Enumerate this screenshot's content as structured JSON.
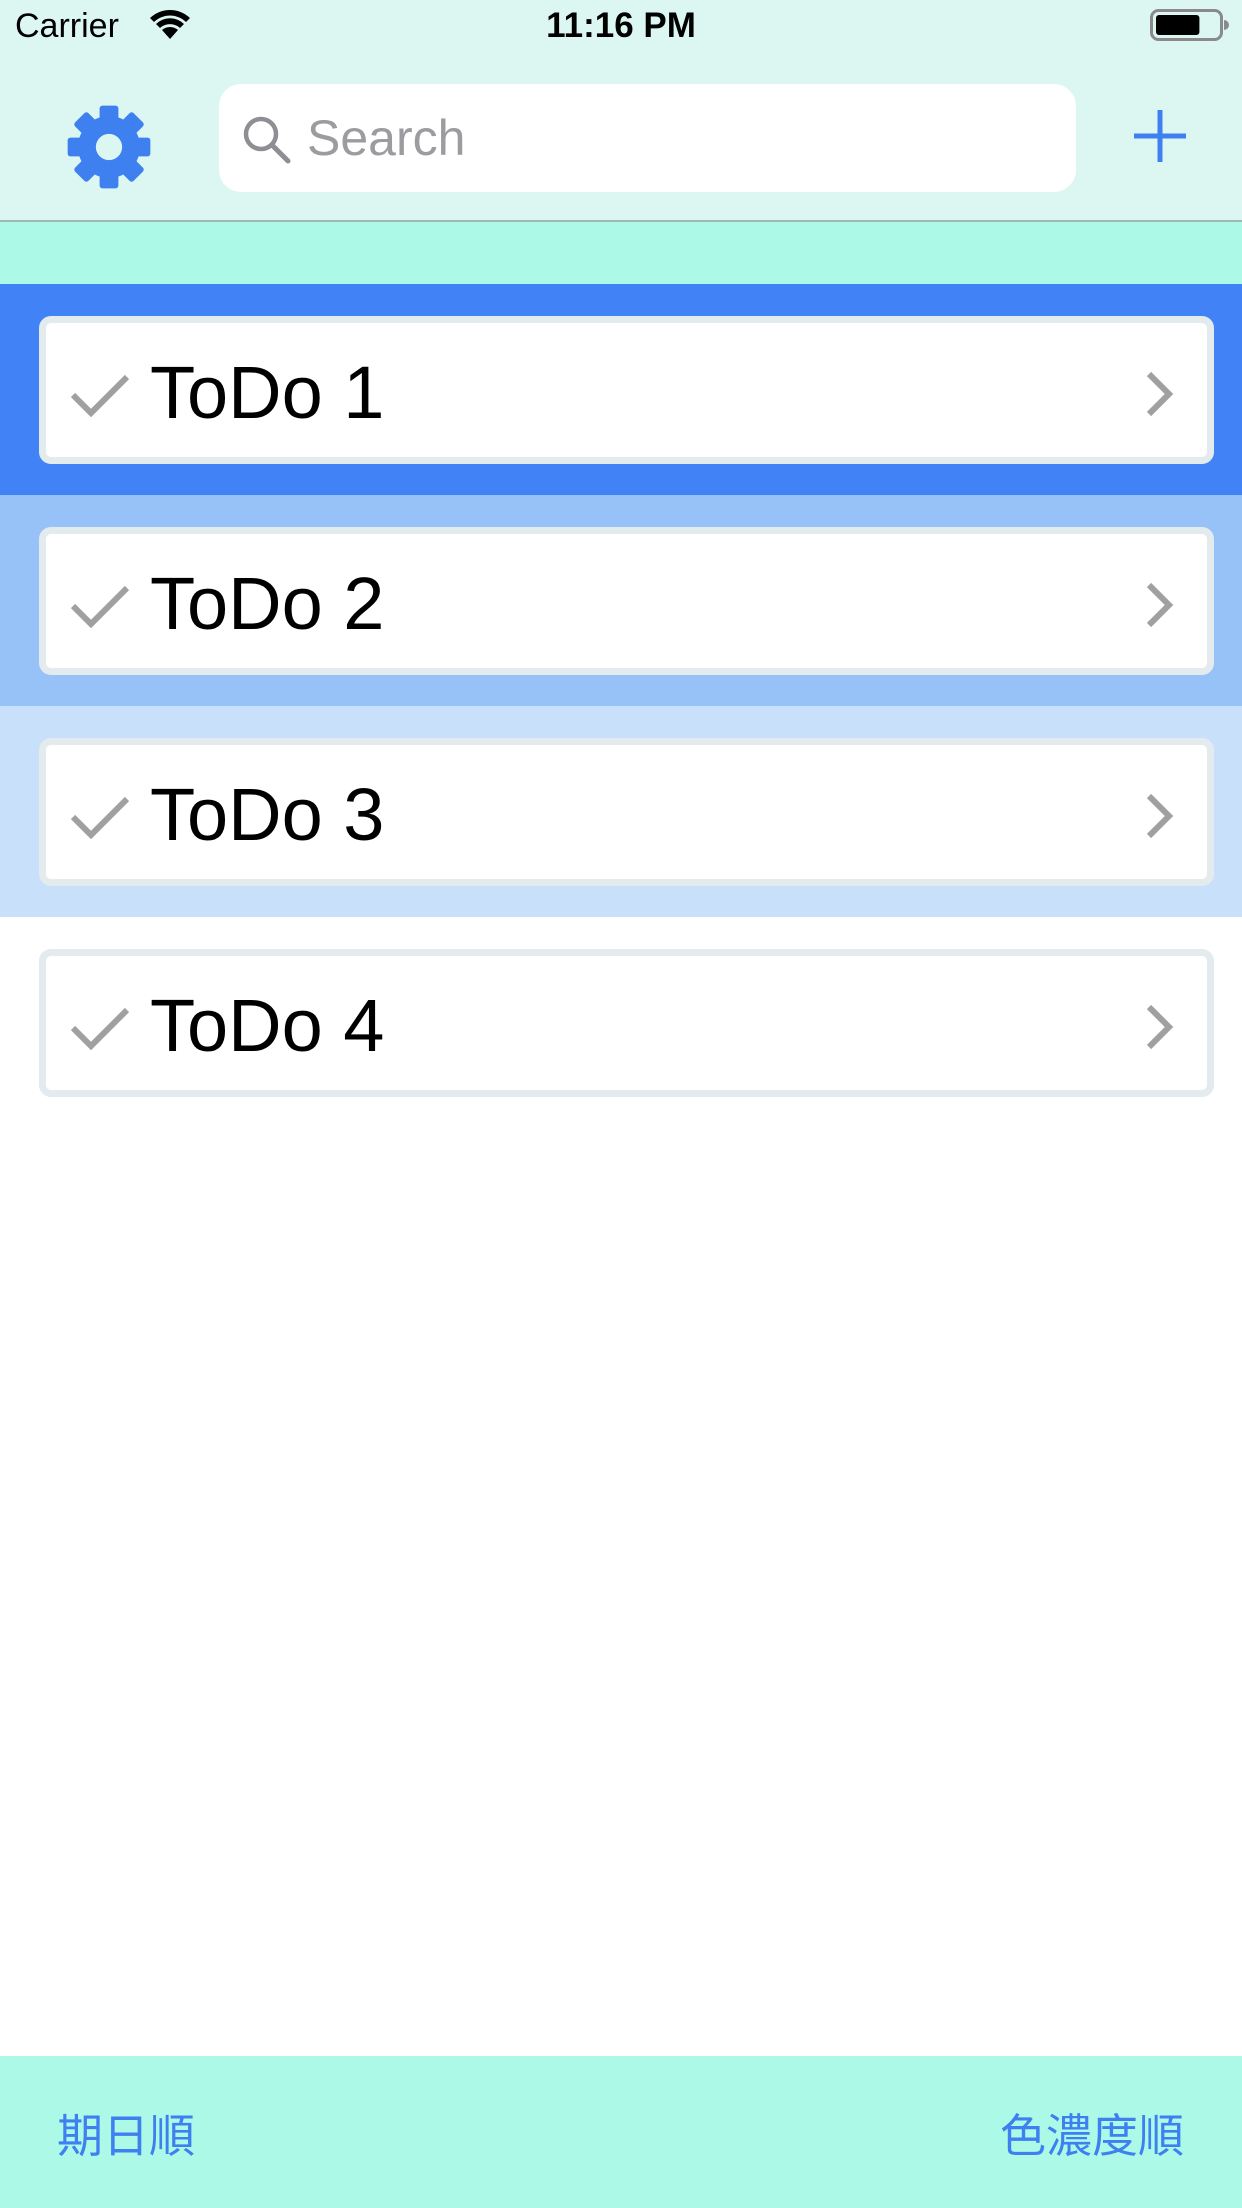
{
  "status_bar": {
    "carrier": "Carrier",
    "time": "11:16 PM",
    "battery_level_percent": 70
  },
  "nav_bar": {
    "settings_icon": "gear-icon",
    "search": {
      "placeholder": "Search",
      "value": ""
    },
    "add_icon": "plus-icon"
  },
  "todos": [
    {
      "title": "ToDo 1",
      "row_color": "#4183f6"
    },
    {
      "title": "ToDo 2",
      "row_color": "#97c2f7"
    },
    {
      "title": "ToDo 3",
      "row_color": "#c8e0fa"
    },
    {
      "title": "ToDo 4",
      "row_color": "#ffffff"
    }
  ],
  "toolbar": {
    "sort_by_date": "期日順",
    "sort_by_color": "色濃度順"
  },
  "colors": {
    "accent": "#3f80f1",
    "bar_background": "#dcf6f1",
    "section_background": "#adf9e7",
    "icon_gray": "#a0a0a0"
  }
}
